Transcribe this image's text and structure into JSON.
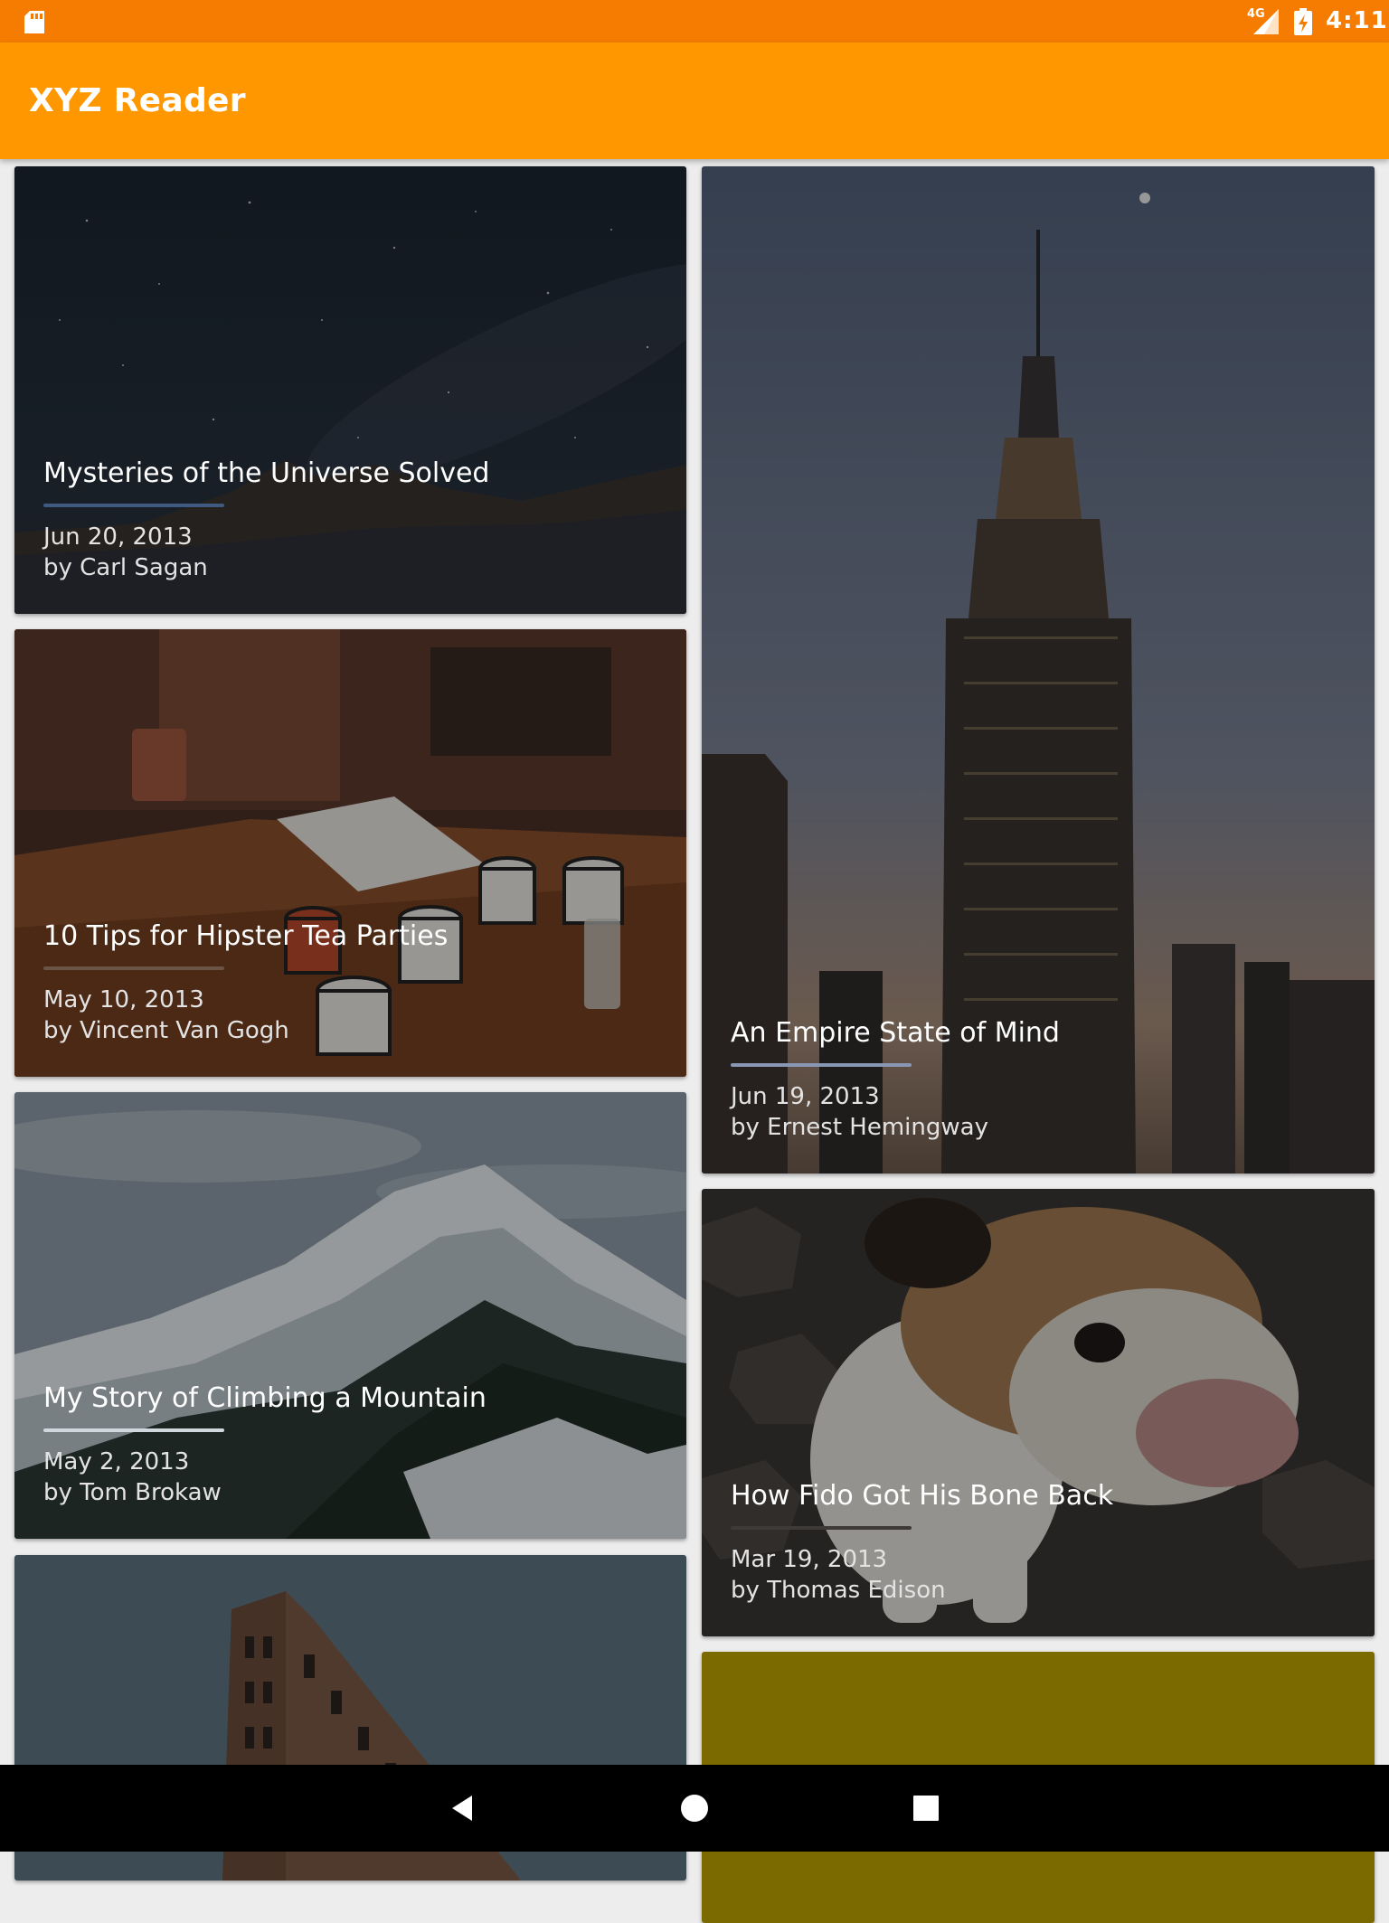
{
  "status_bar": {
    "time": "4:11",
    "network": "4G",
    "icons": [
      "sd-card-icon",
      "cell-signal-icon",
      "battery-charging-icon"
    ]
  },
  "app_bar": {
    "title": "XYZ Reader",
    "color": "#ff9800"
  },
  "articles": [
    {
      "title": "Mysteries of the Universe Solved",
      "date": "Jun 20, 2013",
      "author": "by Carl Sagan",
      "accent": "#3f5a80",
      "image": "night-sky-photo"
    },
    {
      "title": "10 Tips for Hipster Tea Parties",
      "date": "May 10, 2013",
      "author": "by Vincent Van Gogh",
      "accent": "#6a5446",
      "image": "tea-cups-photo"
    },
    {
      "title": "My Story of Climbing a Mountain",
      "date": "May 2, 2013",
      "author": "by Tom Brokaw",
      "accent": "#cfd8dc",
      "image": "snowy-mountain-photo"
    },
    {
      "title": "",
      "date": "",
      "author": "",
      "accent": "#334650",
      "image": "flatiron-building-photo"
    },
    {
      "title": "An Empire State of Mind",
      "date": "Jun 19, 2013",
      "author": "by Ernest Hemingway",
      "accent": "#8a97b4",
      "image": "empire-state-building-photo"
    },
    {
      "title": "How Fido Got His Bone Back",
      "date": "Mar 19, 2013",
      "author": "by Thomas Edison",
      "accent": "#3d3a37",
      "image": "bulldog-photo"
    },
    {
      "title": "",
      "date": "",
      "author": "",
      "accent": "#7b6a00",
      "image": "olive-placeholder"
    }
  ],
  "nav_bar": {
    "icons": [
      "back-icon",
      "home-icon",
      "recent-apps-icon"
    ]
  }
}
